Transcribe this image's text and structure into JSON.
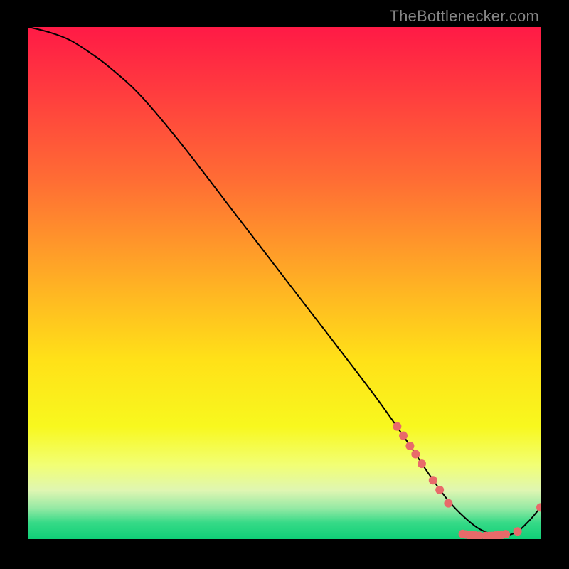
{
  "attribution": "TheBottlenecker.com",
  "chart_data": {
    "type": "line",
    "title": "",
    "xlabel": "",
    "ylabel": "",
    "xlim": [
      0,
      100
    ],
    "ylim": [
      0,
      100
    ],
    "gradient_stops": [
      {
        "offset": 0.0,
        "color": "#ff1a46"
      },
      {
        "offset": 0.12,
        "color": "#ff3a3f"
      },
      {
        "offset": 0.3,
        "color": "#ff6d34"
      },
      {
        "offset": 0.5,
        "color": "#ffb024"
      },
      {
        "offset": 0.65,
        "color": "#ffe118"
      },
      {
        "offset": 0.78,
        "color": "#f8f81e"
      },
      {
        "offset": 0.855,
        "color": "#f2ff74"
      },
      {
        "offset": 0.905,
        "color": "#dff6b2"
      },
      {
        "offset": 0.94,
        "color": "#94e9a4"
      },
      {
        "offset": 0.968,
        "color": "#36da87"
      },
      {
        "offset": 1.0,
        "color": "#0fcf77"
      }
    ],
    "series": [
      {
        "name": "bottleneck-curve",
        "color": "#000000",
        "stroke_width": 2,
        "x": [
          0,
          4,
          8,
          12,
          16,
          22,
          30,
          40,
          50,
          60,
          68,
          74,
          78,
          82,
          86,
          89,
          92,
          95,
          97.5,
          100
        ],
        "y": [
          100,
          99,
          97.5,
          95,
          92,
          86.5,
          77,
          64,
          51,
          38,
          27.5,
          19,
          13,
          7.5,
          3.5,
          1.5,
          0.7,
          1.2,
          3.3,
          6.2
        ]
      }
    ],
    "markers": {
      "name": "highlighted-points",
      "color": "#e86a6a",
      "radius": 6,
      "points": [
        {
          "x": 72.0,
          "y": 22.0
        },
        {
          "x": 73.2,
          "y": 20.2
        },
        {
          "x": 74.5,
          "y": 18.2
        },
        {
          "x": 75.6,
          "y": 16.6
        },
        {
          "x": 76.8,
          "y": 14.7
        },
        {
          "x": 79.0,
          "y": 11.5
        },
        {
          "x": 80.3,
          "y": 9.6
        },
        {
          "x": 82.0,
          "y": 7.0
        },
        {
          "x": 84.8,
          "y": 1.0
        },
        {
          "x": 85.4,
          "y": 0.9
        },
        {
          "x": 86.0,
          "y": 0.8
        },
        {
          "x": 86.7,
          "y": 0.75
        },
        {
          "x": 87.3,
          "y": 0.7
        },
        {
          "x": 88.0,
          "y": 0.65
        },
        {
          "x": 89.3,
          "y": 0.6
        },
        {
          "x": 90.0,
          "y": 0.6
        },
        {
          "x": 90.6,
          "y": 0.6
        },
        {
          "x": 91.2,
          "y": 0.7
        },
        {
          "x": 91.8,
          "y": 0.75
        },
        {
          "x": 92.5,
          "y": 0.85
        },
        {
          "x": 93.2,
          "y": 0.95
        },
        {
          "x": 95.5,
          "y": 1.5
        },
        {
          "x": 100.0,
          "y": 6.2
        }
      ]
    }
  }
}
